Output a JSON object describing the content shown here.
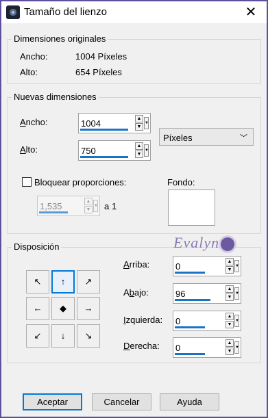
{
  "window": {
    "title": "Tamaño del lienzo",
    "close_glyph": "✕"
  },
  "original": {
    "group_title": "Dimensiones originales",
    "width_label": "Ancho:",
    "width_value": "1004 Píxeles",
    "height_label": "Alto:",
    "height_value": "654 Píxeles"
  },
  "new": {
    "group_title": "Nuevas dimensiones",
    "width_label": "Ancho:",
    "width_value": "1004",
    "height_label": "Alto:",
    "height_value": "750",
    "unit_select": "Píxeles",
    "lock_label": "Bloquear proporciones:",
    "lock_checked": false,
    "ratio_value": "1,535",
    "ratio_suffix": "a 1",
    "background_label": "Fondo:",
    "background_color": "#ffffff"
  },
  "placement": {
    "group_title": "Disposición",
    "anchors": [
      "↖",
      "↑",
      "↗",
      "←",
      "◆",
      "→",
      "↙",
      "↓",
      "↘"
    ],
    "selected_anchor": "top-center",
    "top_label": "Arriba:",
    "top_value": "0",
    "bottom_label": "Abajo:",
    "bottom_value": "96",
    "left_label": "Izquierda:",
    "left_value": "0",
    "right_label": "Derecha:",
    "right_value": "0"
  },
  "watermark": "Evalynda",
  "buttons": {
    "ok": "Aceptar",
    "cancel": "Cancelar",
    "help": "Ayuda"
  },
  "colors": {
    "accent": "#0078d7",
    "value_bar": "#1a73c6",
    "window_border": "#6a5aa8"
  }
}
